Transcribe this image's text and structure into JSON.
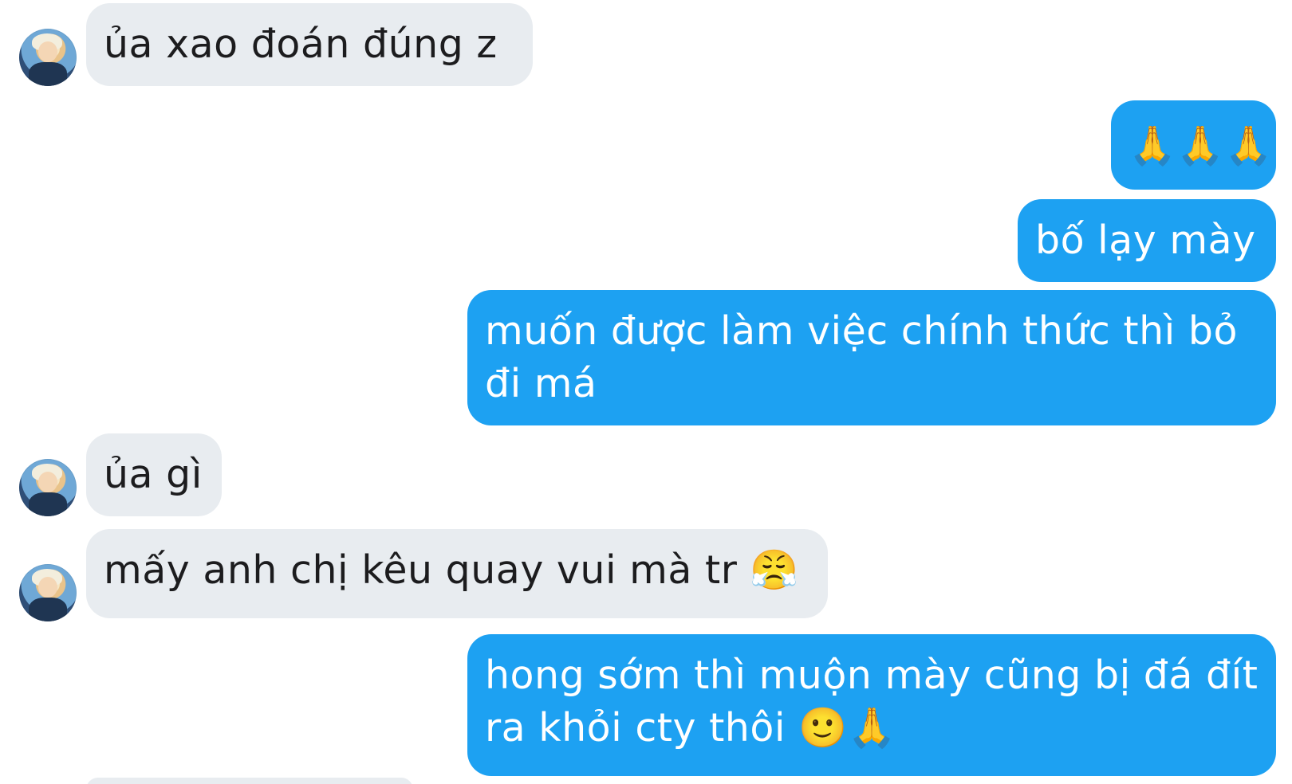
{
  "conversation": {
    "messages": [
      {
        "direction": "incoming",
        "text": "ủa xao đoán đúng z"
      },
      {
        "direction": "outgoing",
        "text": "🙏🙏🙏"
      },
      {
        "direction": "outgoing",
        "text": "bố lạy mày"
      },
      {
        "direction": "outgoing",
        "text": "muốn được làm việc chính thức thì bỏ đi má"
      },
      {
        "direction": "incoming",
        "text": "ủa gì"
      },
      {
        "direction": "incoming",
        "text": "mấy anh chị kêu quay vui mà tr 😤"
      },
      {
        "direction": "outgoing",
        "text": "hong sớm thì muộn mày cũng bị đá đít ra khỏi cty thôi 🙂🙏"
      }
    ]
  },
  "colors": {
    "incoming_bubble": "#e8ecf0",
    "outgoing_bubble": "#1da1f2",
    "outgoing_text": "#ffffff",
    "incoming_text": "#1c1c1e"
  },
  "icons": {
    "avatar": "user-avatar-icon"
  }
}
